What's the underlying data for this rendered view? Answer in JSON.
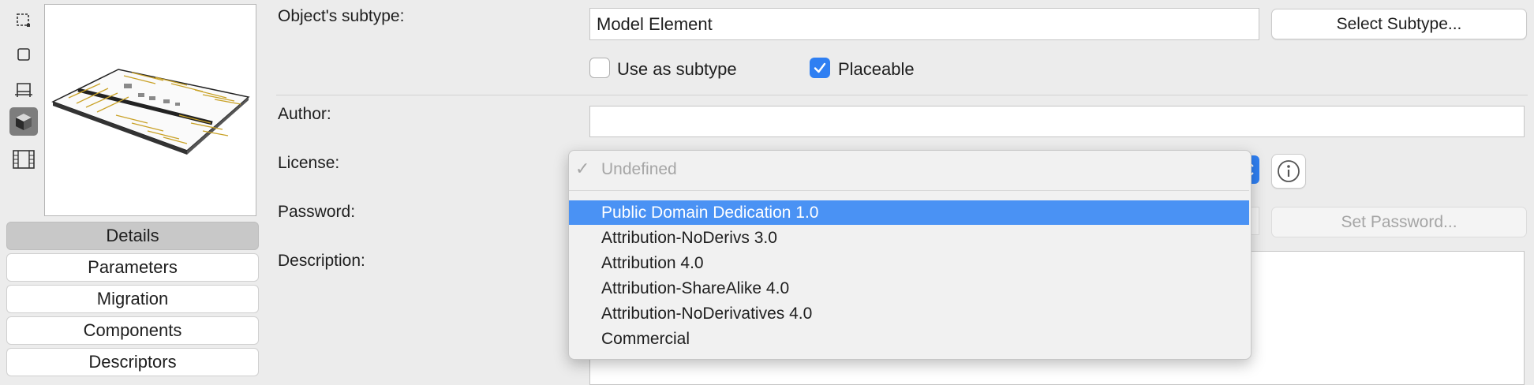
{
  "sidebar": {
    "icons": [
      "2d-symbol-icon",
      "square-icon",
      "table-icon",
      "3d-box-icon",
      "film-icon"
    ]
  },
  "tabs": [
    {
      "label": "Details",
      "selected": true
    },
    {
      "label": "Parameters",
      "selected": false
    },
    {
      "label": "Migration",
      "selected": false
    },
    {
      "label": "Components",
      "selected": false
    },
    {
      "label": "Descriptors",
      "selected": false
    }
  ],
  "form": {
    "subtype_label": "Object's subtype:",
    "subtype_value": "Model Element",
    "select_subtype_button": "Select Subtype...",
    "use_as_subtype_label": "Use as subtype",
    "use_as_subtype_checked": false,
    "placeable_label": "Placeable",
    "placeable_checked": true,
    "author_label": "Author:",
    "author_value": "",
    "license_label": "License:",
    "password_label": "Password:",
    "set_password_button": "Set Password...",
    "description_label": "Description:"
  },
  "license_dropdown": {
    "current": "Undefined",
    "options": [
      "Public Domain Dedication 1.0",
      "Attribution-NoDerivs 3.0",
      "Attribution 4.0",
      "Attribution-ShareAlike 4.0",
      "Attribution-NoDerivatives 4.0",
      "Commercial"
    ],
    "highlighted_index": 0
  },
  "colors": {
    "accent": "#2f7ff2",
    "highlight": "#4a92f4"
  }
}
